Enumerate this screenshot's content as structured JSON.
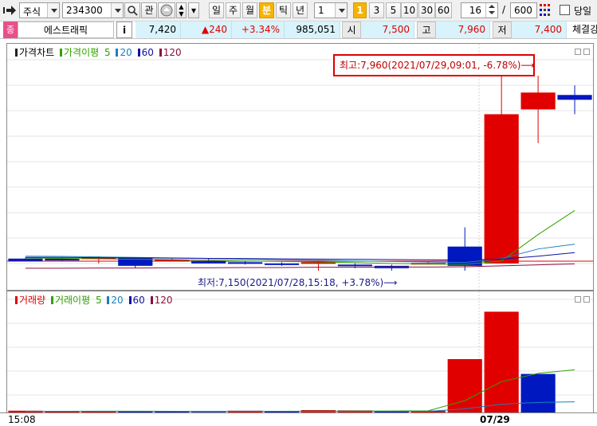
{
  "toolbar": {
    "market_select": "주식",
    "code": "234300",
    "btn_gwan": "관",
    "period_tabs": [
      "일",
      "주",
      "월",
      "분",
      "틱",
      "년"
    ],
    "active_period": "분",
    "interval_select": "1",
    "interval_badge": "1",
    "interval_buttons": [
      "3",
      "5",
      "10",
      "30",
      "60"
    ],
    "count_value": "16",
    "slash": "/",
    "total_value": "600",
    "today_label": "당일"
  },
  "quote": {
    "name": "에스트래픽",
    "info_btn": "i",
    "price": "7,420",
    "change": "▲240",
    "change_pct": "+3.34%",
    "volume": "985,051",
    "open_label": "시",
    "open": "7,500",
    "high_label": "고",
    "high": "7,960",
    "low_label": "저",
    "low": "7,400",
    "trade_label": "체결강"
  },
  "price_chart": {
    "legend_title": "가격차트",
    "ma_label": "가격이평",
    "ma_periods": [
      "5",
      "20",
      "60",
      "120"
    ],
    "high_annotation": "최고:7,960(2021/07/29,09:01, -6.78%)⟶",
    "low_annotation": "최저:7,150(2021/07/28,15:18, +3.78%)⟶"
  },
  "volume_chart": {
    "legend_title": "거래량",
    "ma_label": "거래이평",
    "ma_periods": [
      "5",
      "20",
      "60",
      "120"
    ]
  },
  "x_axis": {
    "start_label": "15:08",
    "date_label": "07/29"
  },
  "colors": {
    "up": "#e00000",
    "down": "#0018c0",
    "ma5": "#33a000",
    "ma20": "#1a7fc0",
    "ma60": "#1010a0",
    "ma120": "#8a1040"
  },
  "chart_data": {
    "type": "candlestick",
    "candles": [
      {
        "o": 7200,
        "h": 7205,
        "l": 7195,
        "c": 7190
      },
      {
        "o": 7200,
        "h": 7205,
        "l": 7190,
        "c": 7192
      },
      {
        "o": 7200,
        "h": 7210,
        "l": 7180,
        "c": 7205
      },
      {
        "o": 7205,
        "h": 7205,
        "l": 7160,
        "c": 7170
      },
      {
        "o": 7195,
        "h": 7200,
        "l": 7190,
        "c": 7196
      },
      {
        "o": 7190,
        "h": 7200,
        "l": 7180,
        "c": 7180
      },
      {
        "o": 7185,
        "h": 7190,
        "l": 7175,
        "c": 7180
      },
      {
        "o": 7180,
        "h": 7185,
        "l": 7170,
        "c": 7178
      },
      {
        "o": 7180,
        "h": 7185,
        "l": 7150,
        "c": 7185
      },
      {
        "o": 7175,
        "h": 7180,
        "l": 7160,
        "c": 7172
      },
      {
        "o": 7170,
        "h": 7175,
        "l": 7150,
        "c": 7160
      },
      {
        "o": 7180,
        "h": 7185,
        "l": 7175,
        "c": 7182
      },
      {
        "o": 7250,
        "h": 7330,
        "l": 7150,
        "c": 7170
      },
      {
        "o": 7180,
        "h": 7960,
        "l": 7180,
        "c": 7800
      },
      {
        "o": 7820,
        "h": 7960,
        "l": 7680,
        "c": 7890
      },
      {
        "o": 7880,
        "h": 7920,
        "l": 7800,
        "c": 7860
      }
    ],
    "ma5": [
      7203,
      7201,
      7199,
      7197,
      7196,
      7193,
      7190,
      7188,
      7186,
      7183,
      7180,
      7178,
      7176,
      7190,
      7300,
      7400
    ],
    "ma20": [
      7210,
      7209,
      7207,
      7205,
      7203,
      7200,
      7197,
      7195,
      7193,
      7190,
      7188,
      7186,
      7184,
      7200,
      7240,
      7260
    ],
    "ma60": [
      7205,
      7205,
      7204,
      7203,
      7202,
      7201,
      7200,
      7199,
      7198,
      7197,
      7196,
      7195,
      7194,
      7198,
      7210,
      7225
    ],
    "ma120": [
      7160,
      7160,
      7161,
      7161,
      7162,
      7162,
      7163,
      7163,
      7164,
      7164,
      7165,
      7165,
      7166,
      7170,
      7174,
      7178
    ],
    "ylim": [
      7100,
      8000
    ],
    "volume": [
      {
        "v": 3000,
        "up": true
      },
      {
        "v": 2500,
        "up": true
      },
      {
        "v": 2000,
        "up": true
      },
      {
        "v": 2000,
        "up": false
      },
      {
        "v": 1500,
        "up": false
      },
      {
        "v": 1000,
        "up": false
      },
      {
        "v": 3000,
        "up": true
      },
      {
        "v": 2000,
        "up": false
      },
      {
        "v": 4000,
        "up": true
      },
      {
        "v": 3500,
        "up": true
      },
      {
        "v": 2000,
        "up": false
      },
      {
        "v": 3000,
        "up": true
      },
      {
        "v": 90000,
        "up": true
      },
      {
        "v": 170000,
        "up": true
      },
      {
        "v": 65000,
        "up": false
      },
      {
        "v": 0,
        "up": false
      }
    ],
    "vol_ma5": [
      2000,
      2000,
      2100,
      2100,
      2000,
      1900,
      2000,
      2000,
      2200,
      2400,
      2500,
      2800,
      20000,
      52000,
      66000,
      72000
    ],
    "vol_ma20": [
      1800,
      1800,
      1800,
      1800,
      1800,
      1800,
      1800,
      1800,
      1900,
      1900,
      2000,
      2000,
      6000,
      14000,
      17000,
      18000
    ],
    "vol_ylim": [
      0,
      180000
    ]
  }
}
